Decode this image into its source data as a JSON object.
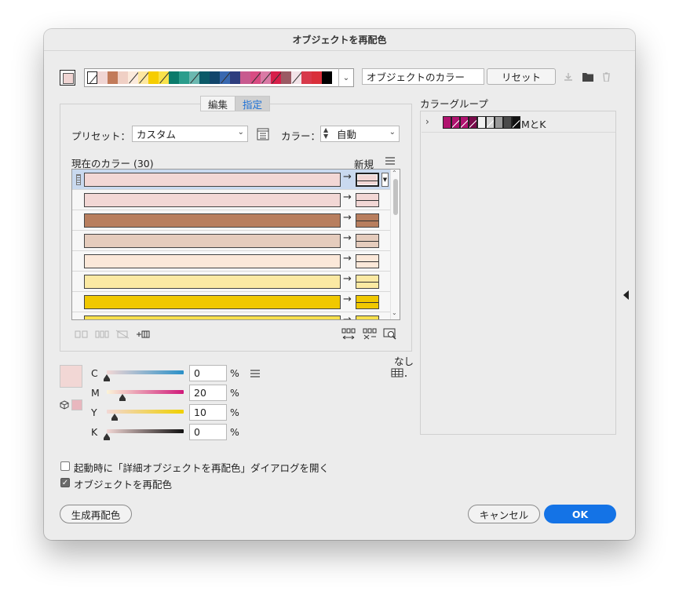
{
  "window": {
    "title": "オブジェクトを再配色"
  },
  "top": {
    "colors_field": "オブジェクトのカラー",
    "reset_label": "リセット",
    "swatches": [
      "#ffffff",
      "#f0d5d3",
      "#c27b5a",
      "#f0d0c5",
      "#fbeadc",
      "#fde7a0",
      "#f6cd00",
      "#f8e24a",
      "#0a7b6b",
      "#2b9d8c",
      "#6bb8b0",
      "#0b5a68",
      "#11456b",
      "#3868b0",
      "#2e3d7e",
      "#c85a8f",
      "#d84c83",
      "#d97aa6",
      "#d71f4a",
      "#9b5a64",
      "#f2e3e8",
      "#d7394a",
      "#d92f3a",
      "#000000"
    ]
  },
  "tabs": [
    {
      "label": "編集"
    },
    {
      "label": "指定"
    }
  ],
  "preset": {
    "label": "プリセット：",
    "value": "カスタム"
  },
  "colors": {
    "label": "カラー：",
    "value": "自動"
  },
  "list": {
    "current_label": "現在のカラー (30)",
    "new_label": "新規",
    "rows": [
      {
        "color": "#f2d7d5",
        "new": "#f2d7d5",
        "selected": true
      },
      {
        "color": "#f2d7d5",
        "new": "#f2d7d5",
        "selected": false
      },
      {
        "color": "#b87e5e",
        "new": "#b87e5e",
        "selected": false
      },
      {
        "color": "#e5ccbd",
        "new": "#e5ccbd",
        "selected": false
      },
      {
        "color": "#fbe8d9",
        "new": "#fbe8d9",
        "selected": false
      },
      {
        "color": "#fbe9a3",
        "new": "#fbe9a3",
        "selected": false
      },
      {
        "color": "#f0c800",
        "new": "#f0c800",
        "selected": false
      },
      {
        "color": "#f7e04e",
        "new": "#f7e04e",
        "selected": false
      }
    ]
  },
  "cmyk": {
    "none_label": "なし",
    "sliders": [
      {
        "letter": "C",
        "value": "0",
        "unit": "%",
        "level": 0
      },
      {
        "letter": "M",
        "value": "20",
        "unit": "%",
        "level": 20
      },
      {
        "letter": "Y",
        "value": "10",
        "unit": "%",
        "level": 10
      },
      {
        "letter": "K",
        "value": "0",
        "unit": "%",
        "level": 0
      }
    ],
    "swatch_color": "#f2d7d5",
    "small_swatch_color": "#e8b7be"
  },
  "color_group": {
    "title": "カラーグループ",
    "group_name": "MとK"
  },
  "options": {
    "show_on_launch": "起動時に「詳細オブジェクトを再配色」ダイアログを開く",
    "recolor_objects": "オブジェクトを再配色"
  },
  "footer": {
    "generative_label": "生成再配色",
    "cancel_label": "キャンセル",
    "ok_label": "OK"
  }
}
